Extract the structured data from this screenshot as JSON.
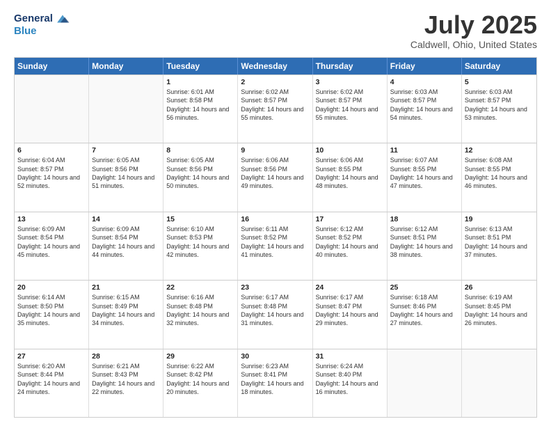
{
  "header": {
    "logo_line1": "General",
    "logo_line2": "Blue",
    "month": "July 2025",
    "location": "Caldwell, Ohio, United States"
  },
  "days_of_week": [
    "Sunday",
    "Monday",
    "Tuesday",
    "Wednesday",
    "Thursday",
    "Friday",
    "Saturday"
  ],
  "weeks": [
    [
      {
        "day": "",
        "sunrise": "",
        "sunset": "",
        "daylight": ""
      },
      {
        "day": "",
        "sunrise": "",
        "sunset": "",
        "daylight": ""
      },
      {
        "day": "1",
        "sunrise": "Sunrise: 6:01 AM",
        "sunset": "Sunset: 8:58 PM",
        "daylight": "Daylight: 14 hours and 56 minutes."
      },
      {
        "day": "2",
        "sunrise": "Sunrise: 6:02 AM",
        "sunset": "Sunset: 8:57 PM",
        "daylight": "Daylight: 14 hours and 55 minutes."
      },
      {
        "day": "3",
        "sunrise": "Sunrise: 6:02 AM",
        "sunset": "Sunset: 8:57 PM",
        "daylight": "Daylight: 14 hours and 55 minutes."
      },
      {
        "day": "4",
        "sunrise": "Sunrise: 6:03 AM",
        "sunset": "Sunset: 8:57 PM",
        "daylight": "Daylight: 14 hours and 54 minutes."
      },
      {
        "day": "5",
        "sunrise": "Sunrise: 6:03 AM",
        "sunset": "Sunset: 8:57 PM",
        "daylight": "Daylight: 14 hours and 53 minutes."
      }
    ],
    [
      {
        "day": "6",
        "sunrise": "Sunrise: 6:04 AM",
        "sunset": "Sunset: 8:57 PM",
        "daylight": "Daylight: 14 hours and 52 minutes."
      },
      {
        "day": "7",
        "sunrise": "Sunrise: 6:05 AM",
        "sunset": "Sunset: 8:56 PM",
        "daylight": "Daylight: 14 hours and 51 minutes."
      },
      {
        "day": "8",
        "sunrise": "Sunrise: 6:05 AM",
        "sunset": "Sunset: 8:56 PM",
        "daylight": "Daylight: 14 hours and 50 minutes."
      },
      {
        "day": "9",
        "sunrise": "Sunrise: 6:06 AM",
        "sunset": "Sunset: 8:56 PM",
        "daylight": "Daylight: 14 hours and 49 minutes."
      },
      {
        "day": "10",
        "sunrise": "Sunrise: 6:06 AM",
        "sunset": "Sunset: 8:55 PM",
        "daylight": "Daylight: 14 hours and 48 minutes."
      },
      {
        "day": "11",
        "sunrise": "Sunrise: 6:07 AM",
        "sunset": "Sunset: 8:55 PM",
        "daylight": "Daylight: 14 hours and 47 minutes."
      },
      {
        "day": "12",
        "sunrise": "Sunrise: 6:08 AM",
        "sunset": "Sunset: 8:55 PM",
        "daylight": "Daylight: 14 hours and 46 minutes."
      }
    ],
    [
      {
        "day": "13",
        "sunrise": "Sunrise: 6:09 AM",
        "sunset": "Sunset: 8:54 PM",
        "daylight": "Daylight: 14 hours and 45 minutes."
      },
      {
        "day": "14",
        "sunrise": "Sunrise: 6:09 AM",
        "sunset": "Sunset: 8:54 PM",
        "daylight": "Daylight: 14 hours and 44 minutes."
      },
      {
        "day": "15",
        "sunrise": "Sunrise: 6:10 AM",
        "sunset": "Sunset: 8:53 PM",
        "daylight": "Daylight: 14 hours and 42 minutes."
      },
      {
        "day": "16",
        "sunrise": "Sunrise: 6:11 AM",
        "sunset": "Sunset: 8:52 PM",
        "daylight": "Daylight: 14 hours and 41 minutes."
      },
      {
        "day": "17",
        "sunrise": "Sunrise: 6:12 AM",
        "sunset": "Sunset: 8:52 PM",
        "daylight": "Daylight: 14 hours and 40 minutes."
      },
      {
        "day": "18",
        "sunrise": "Sunrise: 6:12 AM",
        "sunset": "Sunset: 8:51 PM",
        "daylight": "Daylight: 14 hours and 38 minutes."
      },
      {
        "day": "19",
        "sunrise": "Sunrise: 6:13 AM",
        "sunset": "Sunset: 8:51 PM",
        "daylight": "Daylight: 14 hours and 37 minutes."
      }
    ],
    [
      {
        "day": "20",
        "sunrise": "Sunrise: 6:14 AM",
        "sunset": "Sunset: 8:50 PM",
        "daylight": "Daylight: 14 hours and 35 minutes."
      },
      {
        "day": "21",
        "sunrise": "Sunrise: 6:15 AM",
        "sunset": "Sunset: 8:49 PM",
        "daylight": "Daylight: 14 hours and 34 minutes."
      },
      {
        "day": "22",
        "sunrise": "Sunrise: 6:16 AM",
        "sunset": "Sunset: 8:48 PM",
        "daylight": "Daylight: 14 hours and 32 minutes."
      },
      {
        "day": "23",
        "sunrise": "Sunrise: 6:17 AM",
        "sunset": "Sunset: 8:48 PM",
        "daylight": "Daylight: 14 hours and 31 minutes."
      },
      {
        "day": "24",
        "sunrise": "Sunrise: 6:17 AM",
        "sunset": "Sunset: 8:47 PM",
        "daylight": "Daylight: 14 hours and 29 minutes."
      },
      {
        "day": "25",
        "sunrise": "Sunrise: 6:18 AM",
        "sunset": "Sunset: 8:46 PM",
        "daylight": "Daylight: 14 hours and 27 minutes."
      },
      {
        "day": "26",
        "sunrise": "Sunrise: 6:19 AM",
        "sunset": "Sunset: 8:45 PM",
        "daylight": "Daylight: 14 hours and 26 minutes."
      }
    ],
    [
      {
        "day": "27",
        "sunrise": "Sunrise: 6:20 AM",
        "sunset": "Sunset: 8:44 PM",
        "daylight": "Daylight: 14 hours and 24 minutes."
      },
      {
        "day": "28",
        "sunrise": "Sunrise: 6:21 AM",
        "sunset": "Sunset: 8:43 PM",
        "daylight": "Daylight: 14 hours and 22 minutes."
      },
      {
        "day": "29",
        "sunrise": "Sunrise: 6:22 AM",
        "sunset": "Sunset: 8:42 PM",
        "daylight": "Daylight: 14 hours and 20 minutes."
      },
      {
        "day": "30",
        "sunrise": "Sunrise: 6:23 AM",
        "sunset": "Sunset: 8:41 PM",
        "daylight": "Daylight: 14 hours and 18 minutes."
      },
      {
        "day": "31",
        "sunrise": "Sunrise: 6:24 AM",
        "sunset": "Sunset: 8:40 PM",
        "daylight": "Daylight: 14 hours and 16 minutes."
      },
      {
        "day": "",
        "sunrise": "",
        "sunset": "",
        "daylight": ""
      },
      {
        "day": "",
        "sunrise": "",
        "sunset": "",
        "daylight": ""
      }
    ]
  ]
}
